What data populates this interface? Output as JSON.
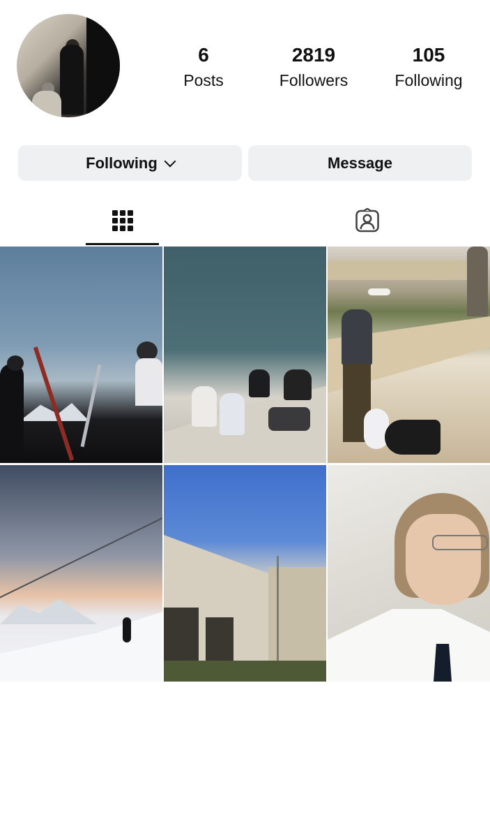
{
  "profile": {
    "stats": {
      "posts_count": "6",
      "posts_label": "Posts",
      "followers_count": "2819",
      "followers_label": "Followers",
      "following_count": "105",
      "following_label": "Following"
    }
  },
  "actions": {
    "following_label": "Following",
    "message_label": "Message"
  },
  "tabs": [
    {
      "icon": "grid-icon",
      "selected": true
    },
    {
      "icon": "tagged-person-icon",
      "selected": false
    }
  ],
  "posts": [
    {
      "id": 1
    },
    {
      "id": 2
    },
    {
      "id": 3
    },
    {
      "id": 4
    },
    {
      "id": 5
    },
    {
      "id": 6
    }
  ]
}
